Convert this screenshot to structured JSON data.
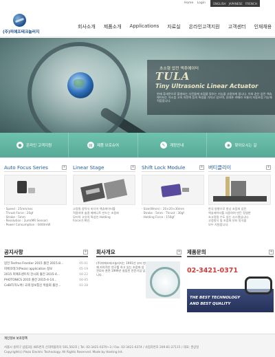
{
  "util": {
    "links": [
      "Home",
      "Login"
    ],
    "languages": [
      "ENGLISH",
      "JAPANESE",
      "FRENCH"
    ]
  },
  "header": {
    "logo_text": "(주)피에조테크놀러지",
    "nav": [
      "회사소개",
      "제품소개",
      "Applications",
      "자료실",
      "온라인고객지원",
      "고객센터",
      "인재채용"
    ]
  },
  "hero": {
    "subtitle": "초소형 압전 액츄에이터",
    "title": "TULA",
    "title2": "Tiny Ultrasonic Linear Actuator",
    "description": "현재 휴대폰으로 촬영되는 사진들에 초점을 맞추는 기능을 사용하게 됩니다. 이와 같은 압전 엑츄에이터는 저소음 고속 저전력 등의 특징을 가지고 있으며, 휴대폰 카메라 모듈의 자동초점 기능에 적합합니다."
  },
  "quick_menu": [
    {
      "icon": "chat-icon",
      "label": "온라인 고객지원"
    },
    {
      "icon": "brochure-icon",
      "label": "제품 브로슈어"
    },
    {
      "icon": "document-icon",
      "label": "계정안내"
    },
    {
      "icon": "map-icon",
      "label": "찾아오시는 길"
    }
  ],
  "products": [
    {
      "title": "Auto Focus Series",
      "lines": [
        "· Speed : 25mm/sec",
        "· Thrust Force : 20gf",
        "· Stroke : 5mm",
        "· Resolution : 2um(MR Sensor)",
        "· Power Consumption : 0400mW"
      ]
    },
    {
      "title": "Linear Stage",
      "lines": [
        "고정밀 갈탁식 비디어 엑츄에이터를",
        "적용하여 솔중 메케니트 만드는 초음파",
        "모터의 고유의 특성인 Holding",
        "Force가 확인."
      ]
    },
    {
      "title": "Shift Lock Module",
      "lines": [
        "· Size(Wmm) : 20×20×30mm",
        "· Stroke : 5mm · Thrust : 30gf",
        "· Holding Force : 150gf"
      ]
    },
    {
      "title": "버티클리이",
      "lines": [
        "한국 방향으로 항상 초음파 압전",
        "엑츄에이터를 사용하여 만든 정밀한",
        "초고정밀 수도 있는 시스템입니다.",
        "고정방식 및 초음파 모터 방식을",
        "모두 지원합니다."
      ]
    }
  ],
  "notice": {
    "title": "공지사항",
    "items": [
      {
        "text": "압전 Tesfmo Frontier 2015 출전 2015.8...",
        "date": "05-01"
      },
      {
        "text": "피에조테크(Piezo) application 정보",
        "date": "05-19"
      },
      {
        "text": "2015 피에조센트릭 전시회 출전 2015-4...",
        "date": "04-22"
      },
      {
        "text": "PHOTONICS 2015 출전 2015-4-14...",
        "date": "04-05"
      },
      {
        "text": "CeBIT(하노버) 국제 정보통신 박람회 출전...",
        "date": "01-28"
      }
    ]
  },
  "about": {
    "title": "회사개요",
    "text": "(주)피에조테크놀러지는 1991년 부터 현재 지속적인 연구를 하고 있는 초음파 압전모터 관련 1999년 설립된 전문기업 입니다."
  },
  "contact": {
    "title": "제품문의",
    "phone": "02-3421-0371",
    "slogan1": "THE BEST TECHNOLOGY",
    "slogan2": "AND BEST QUALITY"
  },
  "footer": {
    "policy": "개인정보 보호정책",
    "address": "서울시 송파구 삼림3동 485번지 신대택플라자 501,502호 | Tel. 02-3421-0370~3 / Fax. 02-3421-0374 / 사업자번호 209-81-27115 / 대표: 권상일",
    "copyright": "Copyright(c) Piezo Electric Technology. All Rights Reserved. Made by Hosting Int."
  }
}
